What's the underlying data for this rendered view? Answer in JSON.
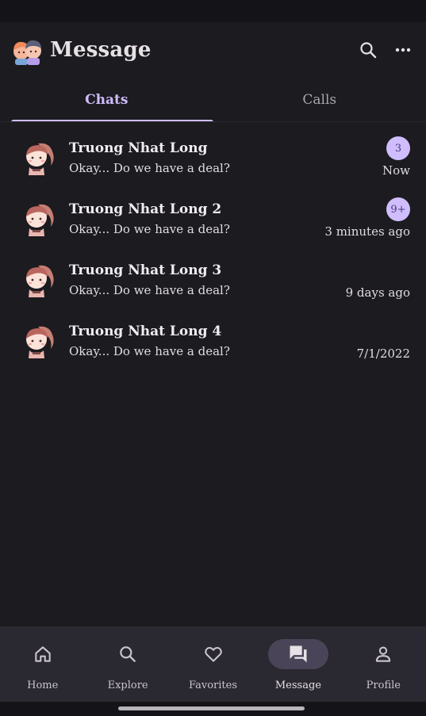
{
  "header": {
    "title": "Message",
    "logo_icon": "couple-avatar-icon",
    "search_icon": "search-icon",
    "more_icon": "more-horiz-icon"
  },
  "tabs": [
    {
      "label": "Chats",
      "active": true
    },
    {
      "label": "Calls",
      "active": false
    }
  ],
  "chats": [
    {
      "name": "Truong Nhat Long",
      "message": "Okay... Do we have a deal?",
      "time": "Now",
      "badge": "3"
    },
    {
      "name": "Truong Nhat Long 2",
      "message": "Okay... Do we have a deal?",
      "time": "3 minutes ago",
      "badge": "9+"
    },
    {
      "name": "Truong Nhat Long 3",
      "message": "Okay... Do we have a deal?",
      "time": "9 days ago",
      "badge": ""
    },
    {
      "name": "Truong Nhat Long 4",
      "message": "Okay... Do we have a deal?",
      "time": "7/1/2022",
      "badge": ""
    }
  ],
  "nav": [
    {
      "label": "Home",
      "icon": "home-icon"
    },
    {
      "label": "Explore",
      "icon": "search-icon"
    },
    {
      "label": "Favorites",
      "icon": "heart-icon"
    },
    {
      "label": "Message",
      "icon": "forum-icon",
      "active": true
    },
    {
      "label": "Profile",
      "icon": "person-icon"
    }
  ],
  "colors": {
    "background": "#1c1b1f",
    "accent": "#cfbdfe",
    "nav_background": "#2a2830",
    "nav_active_pill": "#4a4458"
  }
}
